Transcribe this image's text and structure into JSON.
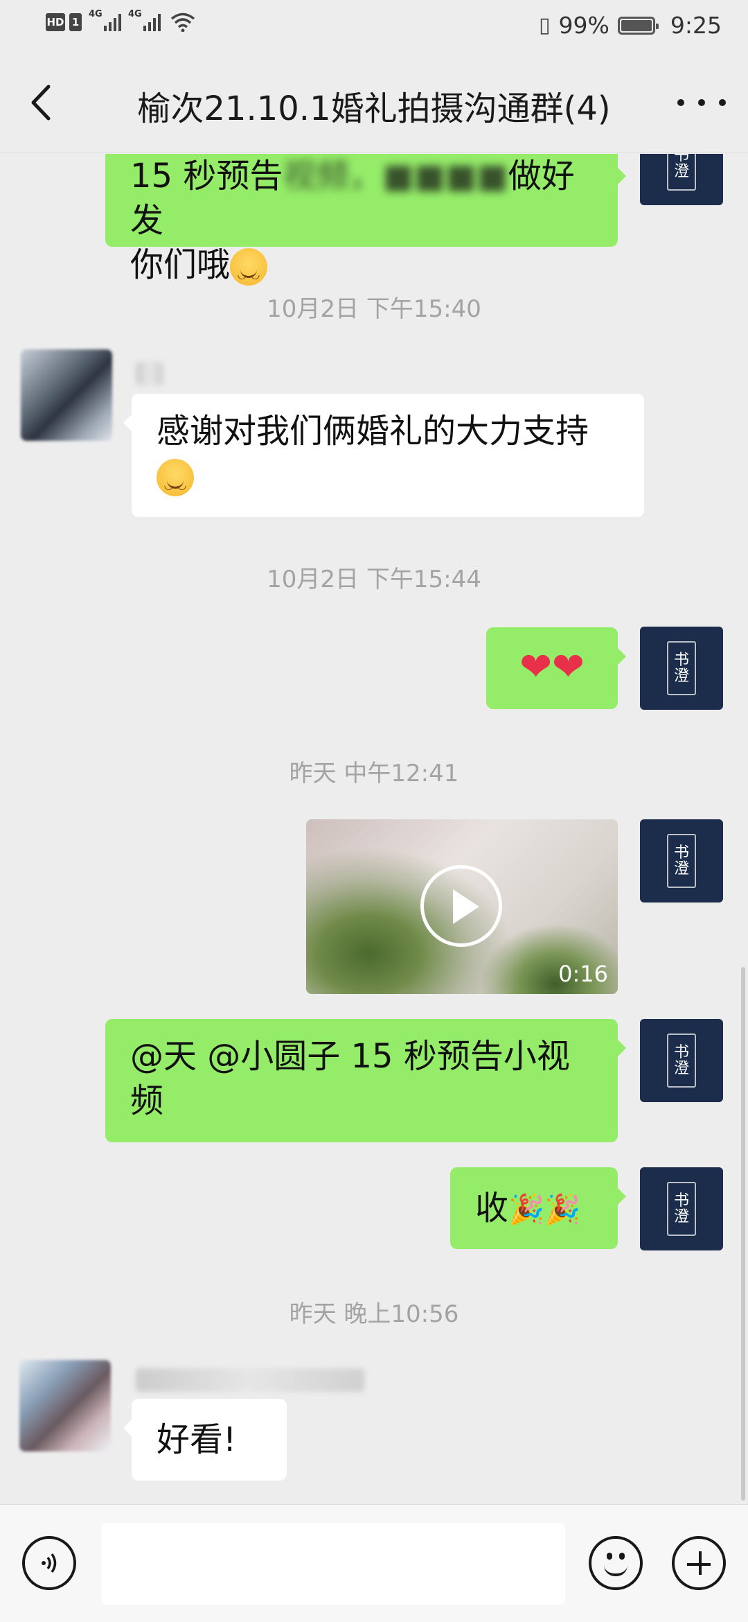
{
  "status_bar": {
    "network_1": "4G",
    "network_2": "4G",
    "hd_label": "HD",
    "sim_label": "1",
    "battery": "99%",
    "time": "9:25"
  },
  "header": {
    "title": "榆次21.10.1婚礼拍摄沟通群(4)"
  },
  "messages": {
    "m0_text_line1": "15 秒预告",
    "m0_text_mid": "做好发",
    "m0_text_line2": "你们哦",
    "t1": "10月2日 下午15:40",
    "m1_text": "感谢对我们俩婚礼的大力支持",
    "t2": "10月2日 下午15:44",
    "m2_text": "❤❤",
    "t3": "昨天 中午12:41",
    "m3_video_duration": "0:16",
    "m4_text_line1": "@天  @小圆子  15 秒预告小视",
    "m4_text_line2": "频",
    "m5_text": "收",
    "m5_emoji": "🎉🎉",
    "t4": "昨天 晚上10:56",
    "m6_text": "好看!"
  },
  "avatar": {
    "seal_text": "书澄"
  },
  "icons": {
    "back": "back-arrow-icon",
    "more": "more-dots-icon",
    "voice": "voice-icon",
    "emoji": "emoji-icon",
    "add": "add-icon",
    "play": "play-icon"
  },
  "colors": {
    "green_bubble": "#95ec69",
    "white_bubble": "#ffffff",
    "background": "#ededed",
    "avatar_navy": "#1b2d4a"
  }
}
